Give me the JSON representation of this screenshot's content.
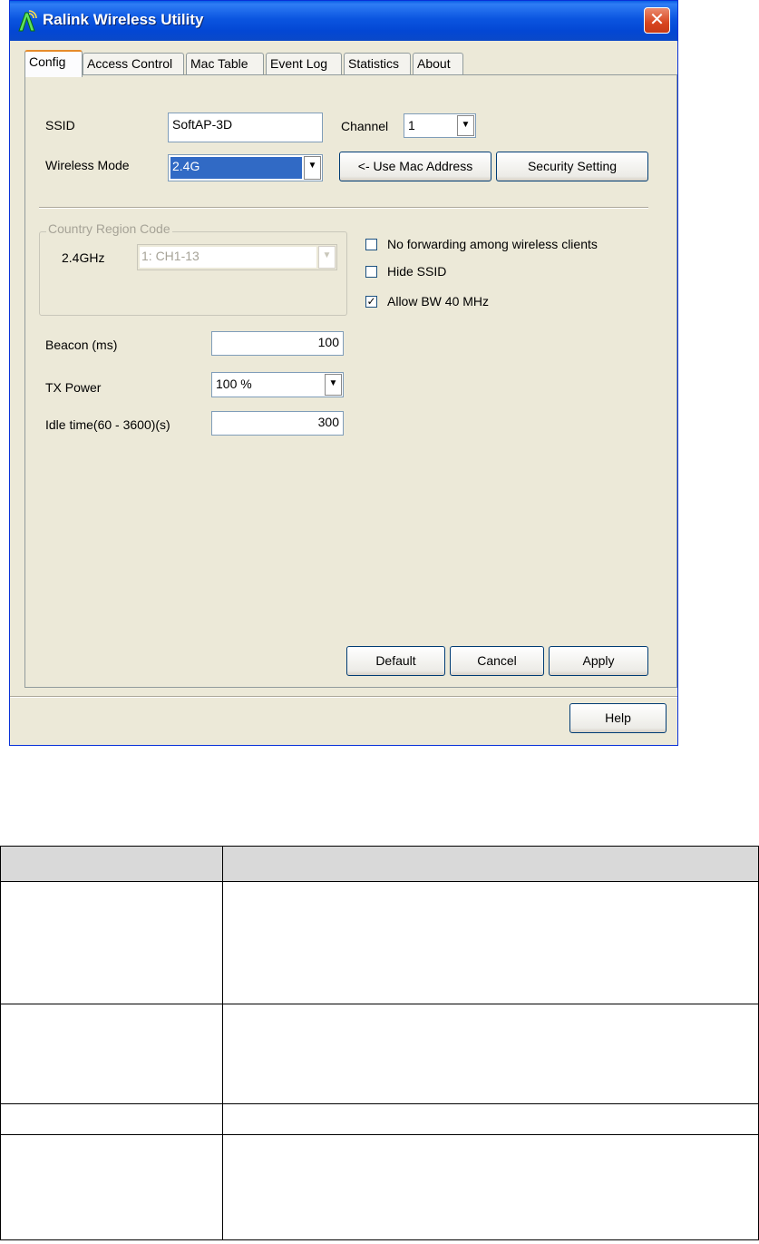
{
  "window": {
    "title": "Ralink Wireless Utility",
    "close_glyph": "✕"
  },
  "tabs": [
    "Config",
    "Access Control",
    "Mac Table",
    "Event Log",
    "Statistics",
    "About"
  ],
  "active_tab": "Config",
  "config": {
    "ssid_label": "SSID",
    "ssid_value": "SoftAP-3D",
    "channel_label": "Channel",
    "channel_value": "1",
    "wireless_mode_label": "Wireless Mode",
    "wireless_mode_value": "2.4G",
    "use_mac_button": "<- Use Mac Address",
    "security_button": "Security Setting",
    "country_group_label": "Country Region Code",
    "band_label": "2.4GHz",
    "region_value": "1: CH1-13",
    "no_forwarding_label": "No forwarding among wireless clients",
    "no_forwarding_checked": false,
    "hide_ssid_label": "Hide SSID",
    "hide_ssid_checked": false,
    "allow_bw_label": "Allow BW 40 MHz",
    "allow_bw_checked": true,
    "check_glyph": "✓",
    "beacon_label": "Beacon (ms)",
    "beacon_value": "100",
    "tx_power_label": "TX Power",
    "tx_power_value": "100 %",
    "idle_label": "Idle time(60 - 3600)(s)",
    "idle_value": "300",
    "default_button": "Default",
    "cancel_button": "Cancel",
    "apply_button": "Apply",
    "dropdown_glyph": "▼"
  },
  "help_button": "Help",
  "colors": {
    "titlebar": "#0b55e0",
    "window_bg": "#ece9d8",
    "close": "#d8461f",
    "selection": "#316ac5",
    "table_header": "#d9d9d9"
  }
}
